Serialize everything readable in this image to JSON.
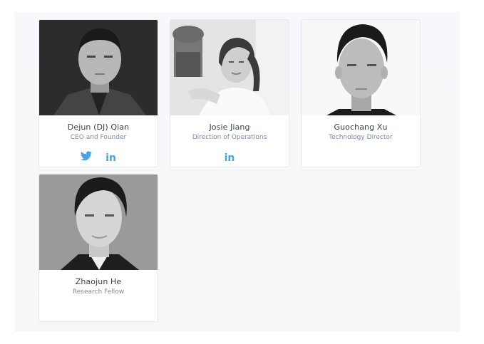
{
  "team": {
    "members": [
      {
        "name": "Dejun (DJ) Qian",
        "role": "CEO and Founder",
        "photo_alt": "portrait",
        "social": [
          "twitter",
          "linkedin"
        ]
      },
      {
        "name": "Josie Jiang",
        "role": "Direction of Operations",
        "photo_alt": "portrait",
        "social": [
          "linkedin"
        ]
      },
      {
        "name": "Guochang Xu",
        "role": "Technology Director",
        "photo_alt": "portrait",
        "social": []
      },
      {
        "name": "Zhaojun He",
        "role": "Research Fellow",
        "photo_alt": "portrait",
        "social": []
      }
    ],
    "linkedin_label": "in",
    "colors": {
      "social_icon": "#4aa3df",
      "name_text": "#3a3f47",
      "role_text": "#7e8ba3"
    }
  }
}
